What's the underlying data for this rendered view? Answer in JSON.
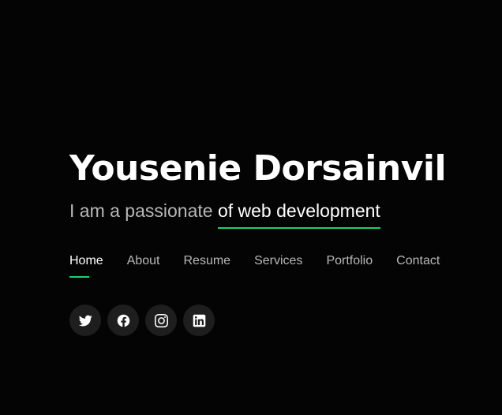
{
  "hero": {
    "name": "Yousenie Dorsainvil",
    "tagline_lead": "I am a passionate ",
    "tagline_typed": "of web development"
  },
  "nav": {
    "items": [
      "Home",
      "About",
      "Resume",
      "Services",
      "Portfolio",
      "Contact"
    ],
    "active": "Home"
  },
  "social": [
    {
      "icon": "twitter-icon"
    },
    {
      "icon": "facebook-icon"
    },
    {
      "icon": "instagram-icon"
    },
    {
      "icon": "linkedin-icon"
    }
  ],
  "colors": {
    "background": "#040404",
    "accent": "#18d26e",
    "muted_text": "#b7b7b7",
    "social_bg": "#1e1e1e"
  }
}
